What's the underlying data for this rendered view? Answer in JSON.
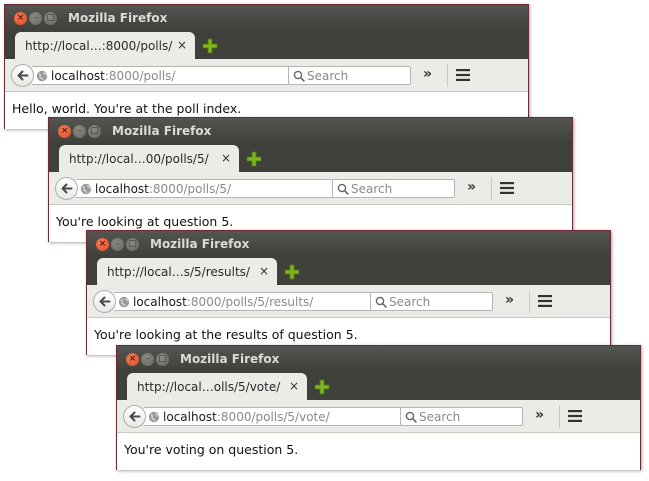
{
  "windows": [
    {
      "title": "Mozilla Firefox",
      "tab_label": "http://local…:8000/polls/",
      "url_host": "localhost",
      "url_path": ":8000/polls/",
      "search_placeholder": "Search",
      "content": "Hello, world. You're at the poll index."
    },
    {
      "title": "Mozilla Firefox",
      "tab_label": "http://local…00/polls/5/",
      "url_host": "localhost",
      "url_path": ":8000/polls/5/",
      "search_placeholder": "Search",
      "content": "You're looking at question 5."
    },
    {
      "title": "Mozilla Firefox",
      "tab_label": "http://local…s/5/results/",
      "url_host": "localhost",
      "url_path": ":8000/polls/5/results/",
      "search_placeholder": "Search",
      "content": "You're looking at the results of question 5."
    },
    {
      "title": "Mozilla Firefox",
      "tab_label": "http://local…olls/5/vote/",
      "url_host": "localhost",
      "url_path": ":8000/polls/5/vote/",
      "search_placeholder": "Search",
      "content": "You're voting on question 5."
    }
  ],
  "icons": {
    "close": "close-icon",
    "minimize": "minimize-icon",
    "maximize": "maximize-icon",
    "tab_close": "close-icon",
    "new_tab": "plus-icon",
    "back": "back-arrow-icon",
    "site": "globe-icon",
    "dropdown": "chevron-down-icon",
    "reload": "reload-icon",
    "search": "magnifier-icon",
    "overflow": "double-chevron-right-icon",
    "menu": "hamburger-menu-icon"
  },
  "colors": {
    "titlebar": "#3f3f3b",
    "toolbar": "#ebebe7",
    "close_button": "#df4a1d",
    "new_tab_plus": "#7cb51d",
    "window_border": "#6b2a34"
  }
}
